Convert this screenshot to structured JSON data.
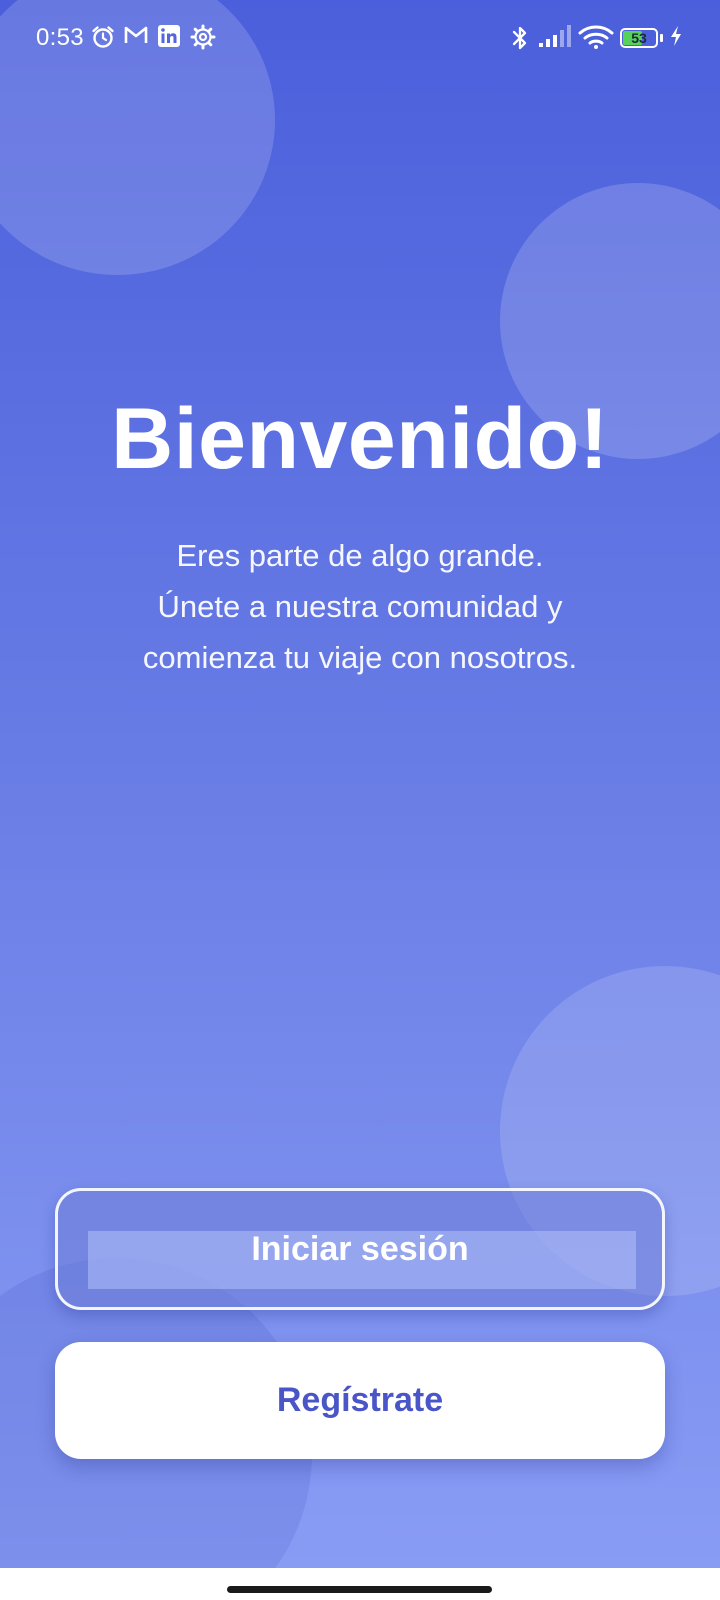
{
  "status_bar": {
    "time": "0:53",
    "left_icons": [
      "alarm-icon",
      "gmail-icon",
      "linkedin-icon",
      "settings-icon"
    ],
    "right_icons": [
      "bluetooth-icon",
      "signal-icon",
      "wifi-icon",
      "battery-icon",
      "charging-icon"
    ],
    "battery_level": "53"
  },
  "welcome": {
    "title": "Bienvenido!",
    "subtitle_lines": [
      "Eres parte de algo grande.",
      "Únete a nuestra comunidad y",
      "comienza tu viaje con nosotros."
    ]
  },
  "actions": {
    "login_label": "Iniciar sesión",
    "register_label": "Regístrate"
  },
  "colors": {
    "background_top": "#4b5fdc",
    "background_bottom": "#8a9df5",
    "register_text": "#4a56c8",
    "battery_fill": "#57d15a"
  }
}
